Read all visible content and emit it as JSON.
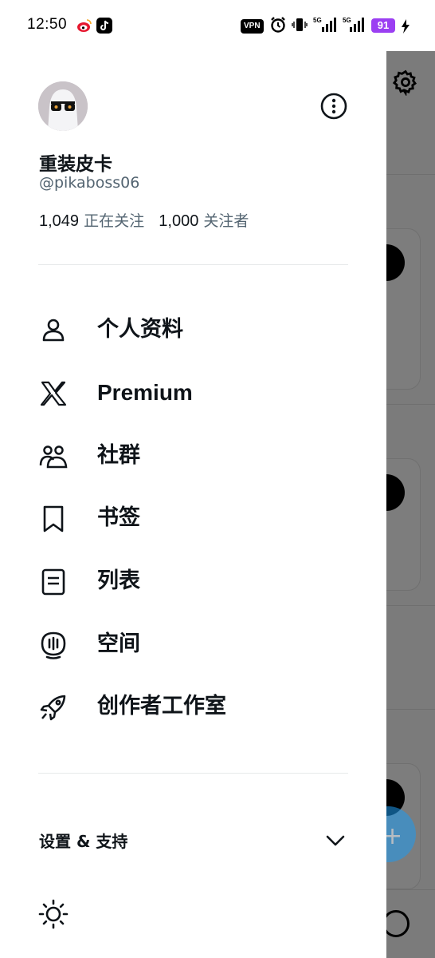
{
  "status_bar": {
    "time": "12:50",
    "vpn_label": "VPN",
    "network_1": "5G",
    "network_2": "5G",
    "battery": "91"
  },
  "profile": {
    "display_name": "重装皮卡",
    "handle": "@pikaboss06",
    "following_count": "1,049",
    "following_label": "正在关注",
    "followers_count": "1,000",
    "followers_label": "关注者"
  },
  "menu": {
    "items": [
      {
        "label": "个人资料",
        "icon": "person-icon"
      },
      {
        "label": "Premium",
        "icon": "x-logo-icon"
      },
      {
        "label": "社群",
        "icon": "communities-icon"
      },
      {
        "label": "书签",
        "icon": "bookmark-icon"
      },
      {
        "label": "列表",
        "icon": "list-icon"
      },
      {
        "label": "空间",
        "icon": "spaces-icon"
      },
      {
        "label": "创作者工作室",
        "icon": "rocket-icon"
      }
    ]
  },
  "settings_support": {
    "label": "设置 & 支持"
  },
  "colors": {
    "primary_text": "#0f1419",
    "secondary_text": "#536471",
    "divider": "#e7e9ea",
    "overlay": "#7b7b7b",
    "accent": "#1d9bf0"
  }
}
